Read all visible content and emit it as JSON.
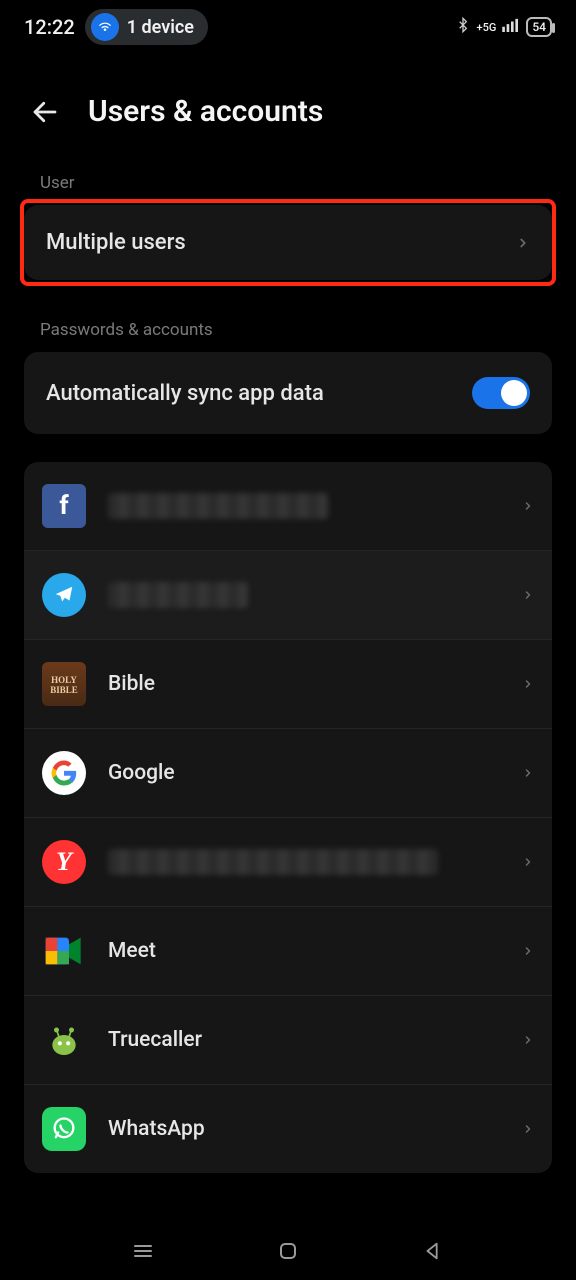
{
  "status": {
    "time": "12:22",
    "device_pill": "1 device",
    "network": "5G",
    "battery": "54"
  },
  "header": {
    "title": "Users & accounts"
  },
  "sections": {
    "user_label": "User",
    "multiple_users": "Multiple users",
    "passwords_label": "Passwords & accounts",
    "auto_sync": "Automatically sync app data"
  },
  "accounts": [
    {
      "app": "Facebook",
      "label": "",
      "icon": "ic-facebook",
      "redacted": true
    },
    {
      "app": "Telegram",
      "label": "",
      "icon": "ic-telegram",
      "redacted": true
    },
    {
      "app": "Bible",
      "label": "Bible",
      "icon": "ic-bible",
      "redacted": false
    },
    {
      "app": "Google",
      "label": "Google",
      "icon": "ic-google",
      "redacted": false
    },
    {
      "app": "Yandex",
      "label": "",
      "icon": "ic-yandex",
      "redacted": true
    },
    {
      "app": "Meet",
      "label": "Meet",
      "icon": "ic-meet",
      "redacted": false
    },
    {
      "app": "Truecaller",
      "label": "Truecaller",
      "icon": "ic-truecaller",
      "redacted": false
    },
    {
      "app": "WhatsApp",
      "label": "WhatsApp",
      "icon": "ic-whatsapp",
      "redacted": false
    }
  ]
}
